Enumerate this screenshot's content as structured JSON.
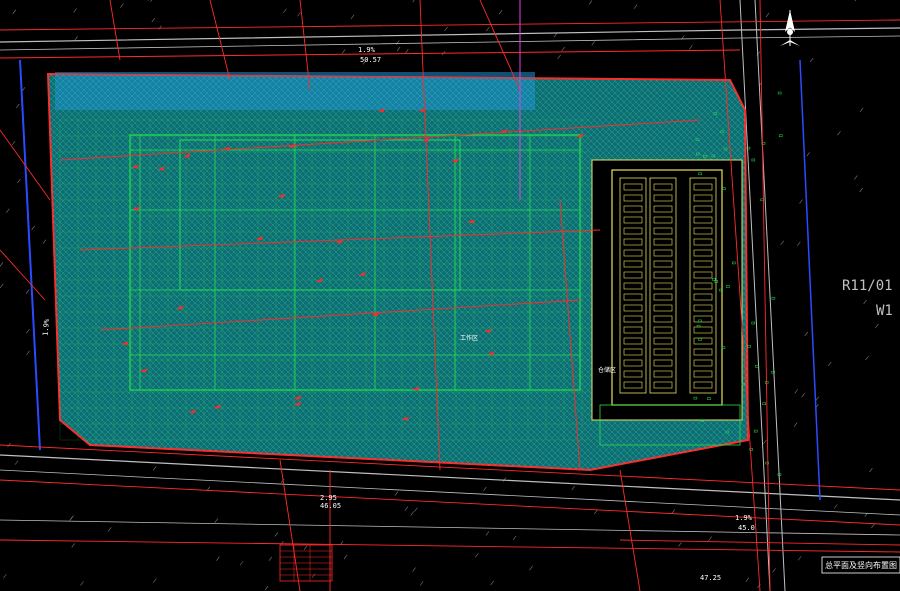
{
  "drawing": {
    "title": "总平面及竖向布置图",
    "background_color": "#000000",
    "colors": {
      "boundary": "#ff2a2a",
      "grid": "#22e04a",
      "site_fill": "#1aa7a8",
      "building": "#e8e35a",
      "road": "#c0c0c0",
      "magenta": "#e040e0",
      "blue": "#2a4bff",
      "white": "#ffffff"
    },
    "labels": {
      "grade_top": "1.9%",
      "elev_top": "50.57",
      "grade_bottom": "1.9%",
      "elev_bottom": "45.0",
      "elev_bottom_left": "2.95",
      "elev_bottom_left2": "46.05",
      "elev_bottom_far": "47.25",
      "grade_left": "1.9%",
      "parcel": "R11/01",
      "parcel2": "W1",
      "site_note": "工作区",
      "building_note": "仓储区"
    },
    "north_arrow": {
      "icon": "north-arrow-icon"
    },
    "legend_table": {
      "title": "",
      "rows": 6
    }
  }
}
